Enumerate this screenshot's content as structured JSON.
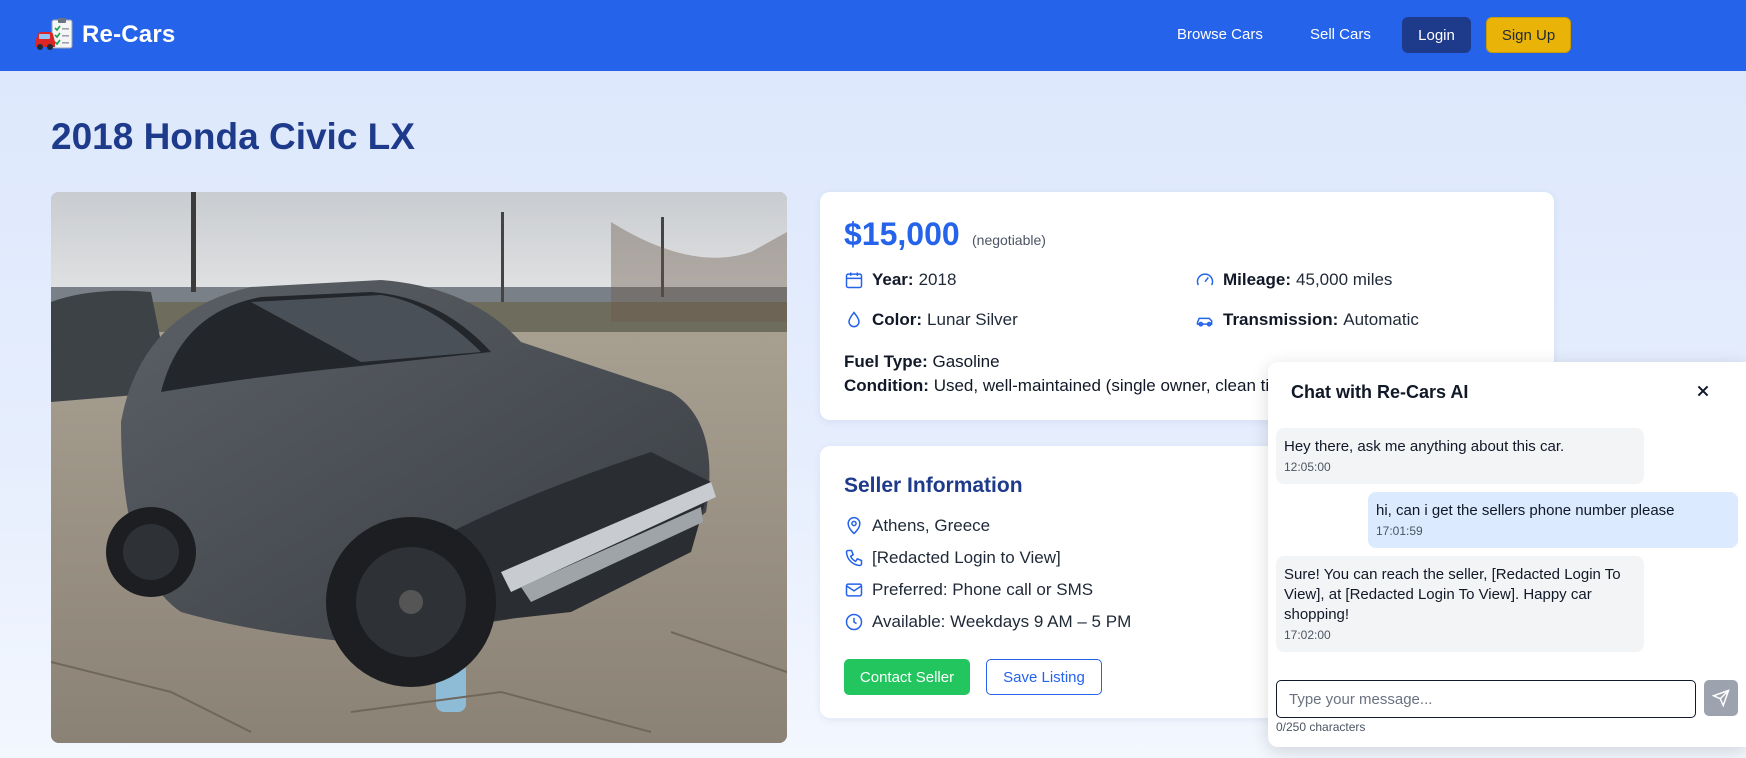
{
  "header": {
    "brand": "Re-Cars",
    "logo_icon": "car-clipboard-icon",
    "nav": {
      "browse": "Browse Cars",
      "sell": "Sell Cars"
    },
    "login_label": "Login",
    "signup_label": "Sign Up",
    "colors": {
      "bar": "#2563eb",
      "login": "#1e3a8a",
      "signup": "#eab308"
    }
  },
  "page": {
    "title": "2018 Honda Civic LX"
  },
  "listing": {
    "price": "$15,000",
    "price_note": "(negotiable)",
    "specs": {
      "year": {
        "label": "Year:",
        "value": "2018",
        "icon": "calendar-icon"
      },
      "mileage": {
        "label": "Mileage:",
        "value": "45,000 miles",
        "icon": "gauge-icon"
      },
      "color": {
        "label": "Color:",
        "value": "Lunar Silver",
        "icon": "droplet-icon"
      },
      "transmission": {
        "label": "Transmission:",
        "value": "Automatic",
        "icon": "car-icon"
      }
    },
    "fuel": {
      "label": "Fuel Type:",
      "value": "Gasoline"
    },
    "condition": {
      "label": "Condition:",
      "value": "Used, well-maintained (single owner, clean ti"
    }
  },
  "seller": {
    "title": "Seller Information",
    "location": "Athens, Greece",
    "phone": "[Redacted Login to View]",
    "preferred": "Preferred: Phone call or SMS",
    "available": "Available: Weekdays 9 AM – 5 PM",
    "contact_label": "Contact Seller",
    "save_label": "Save Listing",
    "colors": {
      "contact": "#22c55e",
      "heading": "#1e3a8a"
    }
  },
  "chat": {
    "title": "Chat with Re-Cars AI",
    "messages": [
      {
        "from": "ai",
        "text": "Hey there, ask me anything about this car.",
        "time": "12:05:00"
      },
      {
        "from": "user",
        "text": "hi, can i get the sellers phone number please",
        "time": "17:01:59"
      },
      {
        "from": "ai",
        "text": "Sure! You can reach the seller, [Redacted Login To View], at [Redacted Login To View]. Happy car shopping!",
        "time": "17:02:00"
      }
    ],
    "input_placeholder": "Type your message...",
    "input_value": "",
    "char_count": "0/250 characters"
  }
}
